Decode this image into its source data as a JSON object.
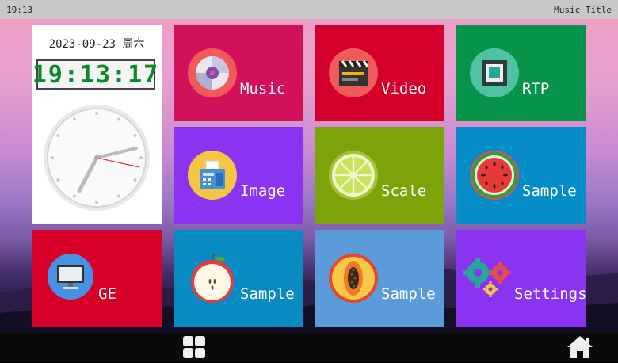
{
  "status_bar": {
    "time": "19:13",
    "title": "Music Title"
  },
  "clock": {
    "date": "2023-09-23 周六",
    "digital_time": "19:13:17"
  },
  "tiles": {
    "music": {
      "label": "Music",
      "color": "#d2105c",
      "icon": "disc-icon"
    },
    "video": {
      "label": "Video",
      "color": "#d3002c",
      "icon": "clapperboard-icon"
    },
    "rtp": {
      "label": "RTP",
      "color": "#07944a",
      "icon": "rtp-icon"
    },
    "image": {
      "label": "Image",
      "color": "#8a34f2",
      "icon": "fax-machine-icon"
    },
    "scale": {
      "label": "Scale",
      "color": "#7ca30a",
      "icon": "lime-icon"
    },
    "sample_1": {
      "label": "Sample",
      "color": "#068cc6",
      "icon": "watermelon-icon"
    },
    "ge": {
      "label": "GE",
      "color": "#d7002a",
      "icon": "monitor-icon"
    },
    "sample_2": {
      "label": "Sample",
      "color": "#0a8ac2",
      "icon": "apple-icon"
    },
    "sample_3": {
      "label": "Sample",
      "color": "#5b9bd9",
      "icon": "papaya-icon"
    },
    "settings": {
      "label": "Settings",
      "color": "#8a34f2",
      "icon": "gears-icon"
    }
  },
  "navbar": {
    "apps_icon": "grid-icon",
    "home_icon": "home-icon"
  }
}
